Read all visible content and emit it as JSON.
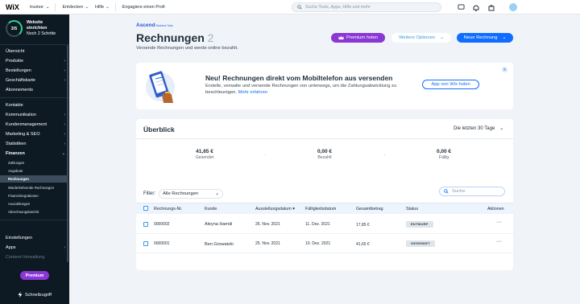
{
  "topbar": {
    "logo": "WiX",
    "site_name": "trustee",
    "nav": [
      "Entdecken",
      "Hilfe",
      "Engagiere einen Profi"
    ],
    "search_placeholder": "Suche Tools, Apps, Hilfe und mehr"
  },
  "sidebar": {
    "setup": {
      "progress": "3/5",
      "title_1": "Website",
      "title_2": "einrichten",
      "sub": "Noch 2 Schritte"
    },
    "items": [
      {
        "label": "Übersicht",
        "chevron": false
      },
      {
        "label": "Produkte",
        "chevron": true
      },
      {
        "label": "Bestellungen",
        "chevron": true
      },
      {
        "label": "Geschäftskarte",
        "chevron": true
      },
      {
        "label": "Abonnements",
        "chevron": false
      },
      {
        "label": "Kontakte",
        "chevron": false
      },
      {
        "label": "Kommunikation",
        "chevron": true
      },
      {
        "label": "Kundenmanagement",
        "chevron": true
      },
      {
        "label": "Marketing & SEO",
        "chevron": true
      },
      {
        "label": "Statistiken",
        "chevron": true
      },
      {
        "label": "Finanzen",
        "chevron": true
      },
      {
        "label": "Einstellungen",
        "chevron": false
      },
      {
        "label": "Apps",
        "chevron": true
      },
      {
        "label": "Content-Verwaltung",
        "chevron": false
      }
    ],
    "sub_items": [
      "Zahlungen",
      "Angebote",
      "Rechnungen",
      "Wiederkehrende Rechnungen",
      "Finanzintegrationen",
      "Auszahlungen",
      "Abrechnungsbericht"
    ],
    "premium": "Premium",
    "quick_access": "Schnellzugriff"
  },
  "header": {
    "brand": "Ascend",
    "brand_sub": "Business Tools",
    "title": "Rechnungen",
    "count": "2",
    "subtitle": "Versende Rechnungen und werde online bezahlt.",
    "premium_button": "Premium holen",
    "more_button": "Weitere Optionen",
    "new_button": "Neue Rechnung"
  },
  "promo": {
    "title": "Neu! Rechnungen direkt vom Mobiltelefon aus versenden",
    "desc": "Erstelle, verwalte und versende Rechnungen von unterwegs, um die Zahlungsabwicklung zu beschleunigen.",
    "link": "Mehr erfahren",
    "button": "App von Wix holen"
  },
  "overview": {
    "title": "Überblick",
    "range": "Die letzten 30 Tage",
    "stats": [
      {
        "value": "41,65 €",
        "label": "Gesendet"
      },
      {
        "value": "0,00 €",
        "label": "Bezahlt"
      },
      {
        "value": "0,00 €",
        "label": "Fällig"
      }
    ]
  },
  "table": {
    "filter_label": "Filter:",
    "filter_value": "Alle Rechnungen",
    "search_placeholder": "Suche",
    "columns": [
      "Rechnungs-Nr.",
      "Kunde",
      "Ausstellungsdatum",
      "Fälligkeitsdatum",
      "Gesamtbetrag",
      "Status",
      "Aktionen"
    ],
    "rows": [
      {
        "nr": "0000002",
        "kunde": "Aleyna Hamdi",
        "ausstellung": "26. Nov. 2021",
        "faellig": "11. Dez. 2021",
        "betrag": "17,85 €",
        "status": "ENTWURF"
      },
      {
        "nr": "0000001",
        "kunde": "Ben Growatzki",
        "ausstellung": "25. Nov. 2021",
        "faellig": "10. Dez. 2021",
        "betrag": "41,65 €",
        "status": "GESENDET"
      }
    ]
  },
  "colors": {
    "accent": "#116dff",
    "premium": "#8a37d6",
    "sidebar": "#0d1923"
  }
}
